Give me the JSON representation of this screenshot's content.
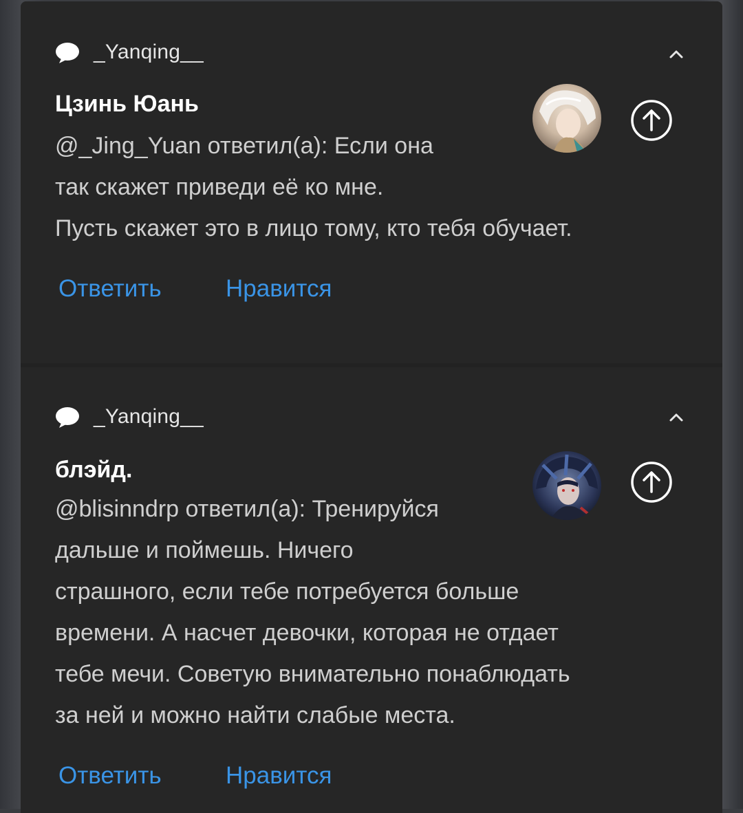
{
  "notifications": [
    {
      "app_name": "_Yanqing__",
      "title": "Цзинь Юань",
      "message": "@_Jing_Yuan ответил(а): Если она\nтак скажет приведи её ко мне.\nПусть скажет это в лицо тому, кто тебя обучает.",
      "actions": {
        "reply": "Ответить",
        "like": "Нравится"
      }
    },
    {
      "app_name": "_Yanqing__",
      "title": "блэйд.",
      "message": "@blisinndrp ответил(а): Тренируйся\nдальше и поймешь. Ничего\nстрашного, если тебе потребуется больше\nвремени. А насчет девочки, которая не отдает\nтебе мечи. Советую внимательно понаблюдать\nза ней и можно найти слабые места.",
      "actions": {
        "reply": "Ответить",
        "like": "Нравится"
      }
    }
  ],
  "colors": {
    "background": "#262626",
    "link": "#3a94e6",
    "title": "#ffffff",
    "body": "#cfcfcf"
  },
  "icons": {
    "app": "speech-bubble-icon",
    "collapse": "chevron-up-icon",
    "action": "arrow-up-circle-icon"
  }
}
